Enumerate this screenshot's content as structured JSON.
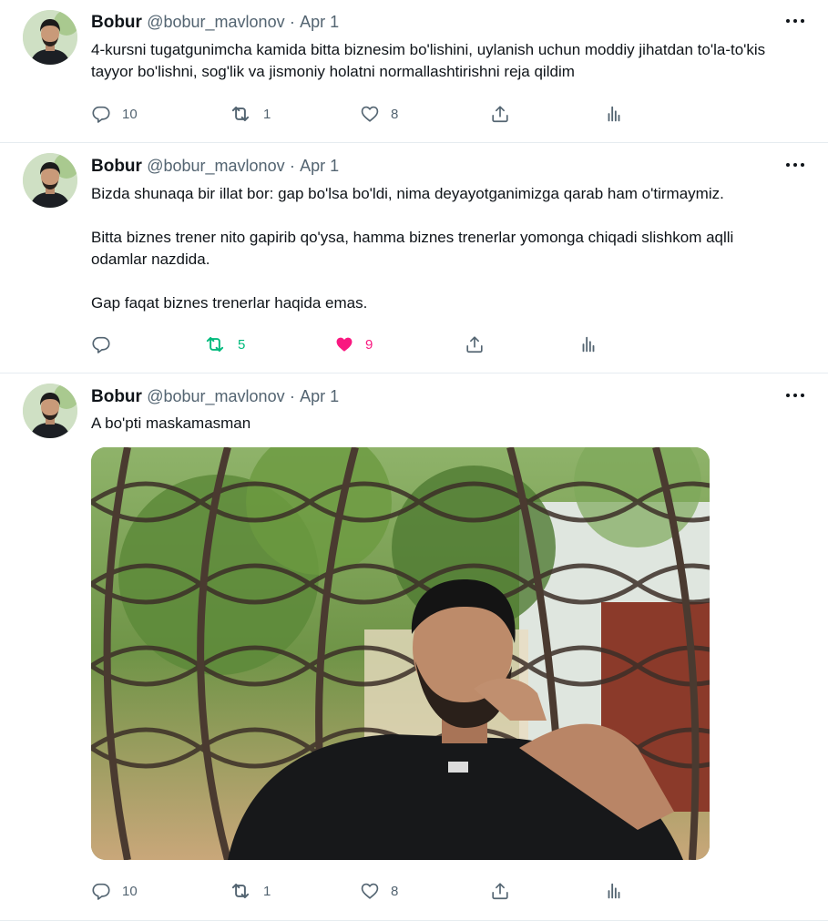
{
  "tweets": [
    {
      "author": "Bobur",
      "handle": "@bobur_mavlonov",
      "separator": "·",
      "date": "Apr 1",
      "text": "4-kursni tugatgunimcha kamida bitta biznesim bo'lishini, uylanish uchun moddiy jihatdan to'la-to'kis tayyor bo'lishni, sog'lik va jismoniy holatni normallashtirishni reja qildim",
      "replies": "10",
      "retweets": "1",
      "likes": "8",
      "retweeted": false,
      "liked": false
    },
    {
      "author": "Bobur",
      "handle": "@bobur_mavlonov",
      "separator": "·",
      "date": "Apr 1",
      "text": "Bizda shunaqa bir illat bor: gap bo'lsa bo'ldi, nima deyayotganimizga qarab ham o'tirmaymiz.\n\nBitta biznes trener nito gapirib qo'ysa, hamma biznes trenerlar yomonga chiqadi slishkom aqlli odamlar nazdida.\n\nGap faqat biznes trenerlar haqida emas.",
      "replies": "",
      "retweets": "5",
      "likes": "9",
      "retweeted": true,
      "liked": true
    },
    {
      "author": "Bobur",
      "handle": "@bobur_mavlonov",
      "separator": "·",
      "date": "Apr 1",
      "text": "A bo'pti maskamasman",
      "replies": "10",
      "retweets": "1",
      "likes": "8",
      "retweeted": false,
      "liked": false,
      "has_photo": true
    }
  ],
  "icons": {
    "reply": "reply-icon",
    "retweet": "retweet-icon",
    "like": "heart-icon",
    "share": "share-icon",
    "analytics": "analytics-icon",
    "more": "more-icon"
  },
  "colors": {
    "text": "#0f1419",
    "secondary": "#536471",
    "retweet_active": "#00ba7c",
    "like_active": "#f91880",
    "divider": "#e6ecf0"
  }
}
